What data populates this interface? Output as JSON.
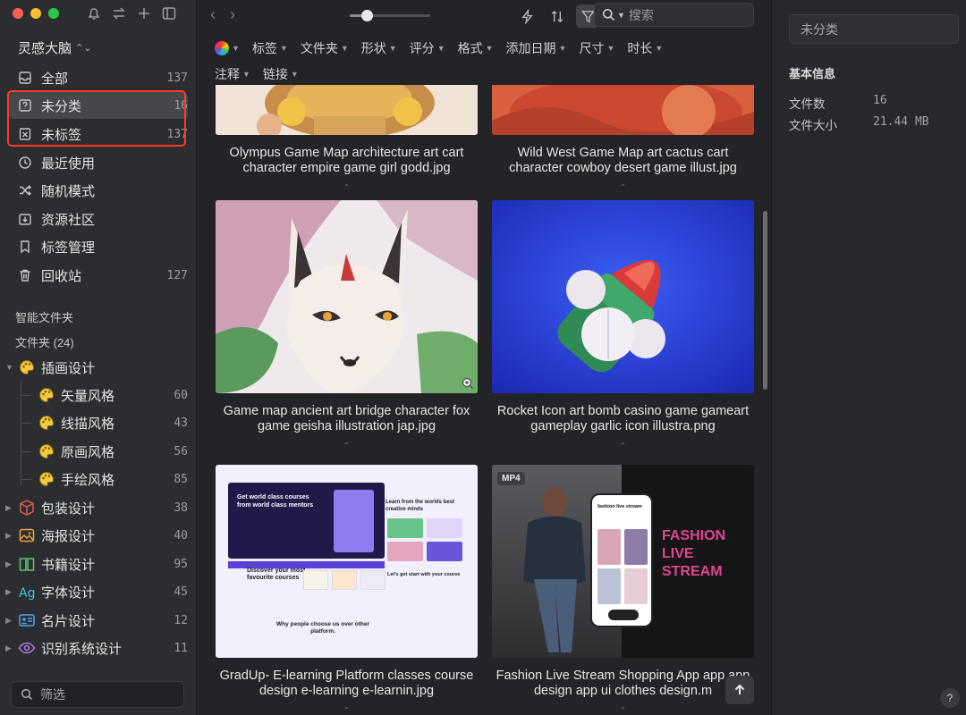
{
  "sidebar": {
    "library_name": "灵感大脑",
    "nav": [
      {
        "label": "全部",
        "count": "137",
        "icon": "inbox-icon"
      },
      {
        "label": "未分类",
        "count": "16",
        "icon": "question-square-icon"
      },
      {
        "label": "未标签",
        "count": "137",
        "icon": "tag-off-icon"
      },
      {
        "label": "最近使用",
        "count": "",
        "icon": "clock-icon"
      },
      {
        "label": "随机模式",
        "count": "",
        "icon": "shuffle-icon"
      },
      {
        "label": "资源社区",
        "count": "",
        "icon": "download-box-icon"
      },
      {
        "label": "标签管理",
        "count": "",
        "icon": "bookmark-icon"
      },
      {
        "label": "回收站",
        "count": "127",
        "icon": "trash-icon"
      }
    ],
    "smart_folders_title": "智能文件夹",
    "folders_title": "文件夹 (24)",
    "folders": [
      {
        "label": "插画设计",
        "count": "",
        "icon": "palette-icon"
      },
      {
        "label": "矢量风格",
        "count": "60",
        "icon": "palette-icon"
      },
      {
        "label": "线描风格",
        "count": "43",
        "icon": "palette-icon"
      },
      {
        "label": "原画风格",
        "count": "56",
        "icon": "palette-icon"
      },
      {
        "label": "手绘风格",
        "count": "85",
        "icon": "palette-icon"
      },
      {
        "label": "包装设计",
        "count": "38",
        "icon": "box-icon"
      },
      {
        "label": "海报设计",
        "count": "40",
        "icon": "image-icon"
      },
      {
        "label": "书籍设计",
        "count": "95",
        "icon": "book-icon"
      },
      {
        "label": "字体设计",
        "count": "45",
        "icon": "font-icon"
      },
      {
        "label": "名片设计",
        "count": "12",
        "icon": "id-card-icon"
      },
      {
        "label": "识别系统设计",
        "count": "11",
        "icon": "eye-icon"
      }
    ],
    "filter_placeholder": "筛选"
  },
  "toolbar": {
    "search_placeholder": "搜索",
    "zoom_level": 0.15
  },
  "filters": [
    "标签",
    "文件夹",
    "形状",
    "评分",
    "格式",
    "添加日期",
    "尺寸",
    "时长",
    "注释",
    "链接"
  ],
  "cards": [
    {
      "caption": "Olympus Game Map architecture art cart character empire game girl godd.jpg",
      "note": "-"
    },
    {
      "caption": "Wild West Game Map art cactus cart character cowboy desert game illust.jpg",
      "note": "-"
    },
    {
      "caption": "Game map ancient art bridge character fox game geisha illustration jap.jpg",
      "note": "-"
    },
    {
      "caption": "Rocket Icon art bomb casino game gameart gameplay garlic icon illustra.png",
      "note": "-"
    },
    {
      "caption": "GradUp- E-learning Platform classes course design e-learning e-learnin.jpg",
      "note": "-"
    },
    {
      "caption": "Fashion Live Stream Shopping App app app design app ui clothes design.m",
      "note": "-",
      "badge": "MP4"
    }
  ],
  "thumb_text": {
    "edu_hero": "Get world class courses from world class mentors",
    "edu_discover": "Discover your most favourite courses",
    "edu_learn": "Learn from the worlds best creative minds",
    "edu_start": "Let's get start with your course",
    "edu_why": "Why people choose us over other platform.",
    "fashion_title": "FASHION LIVE STREAM",
    "fashion_app": "fashion live stream"
  },
  "inspector": {
    "title_placeholder": "未分类",
    "section": "基本信息",
    "rows": [
      {
        "key": "文件数",
        "value": "16"
      },
      {
        "key": "文件大小",
        "value": "21.44 MB"
      }
    ],
    "help": "?"
  },
  "colors": {
    "highlight": "#ff3b22",
    "accent_fashion": "#e0468c",
    "edu_purple": "#5b3fd6"
  }
}
